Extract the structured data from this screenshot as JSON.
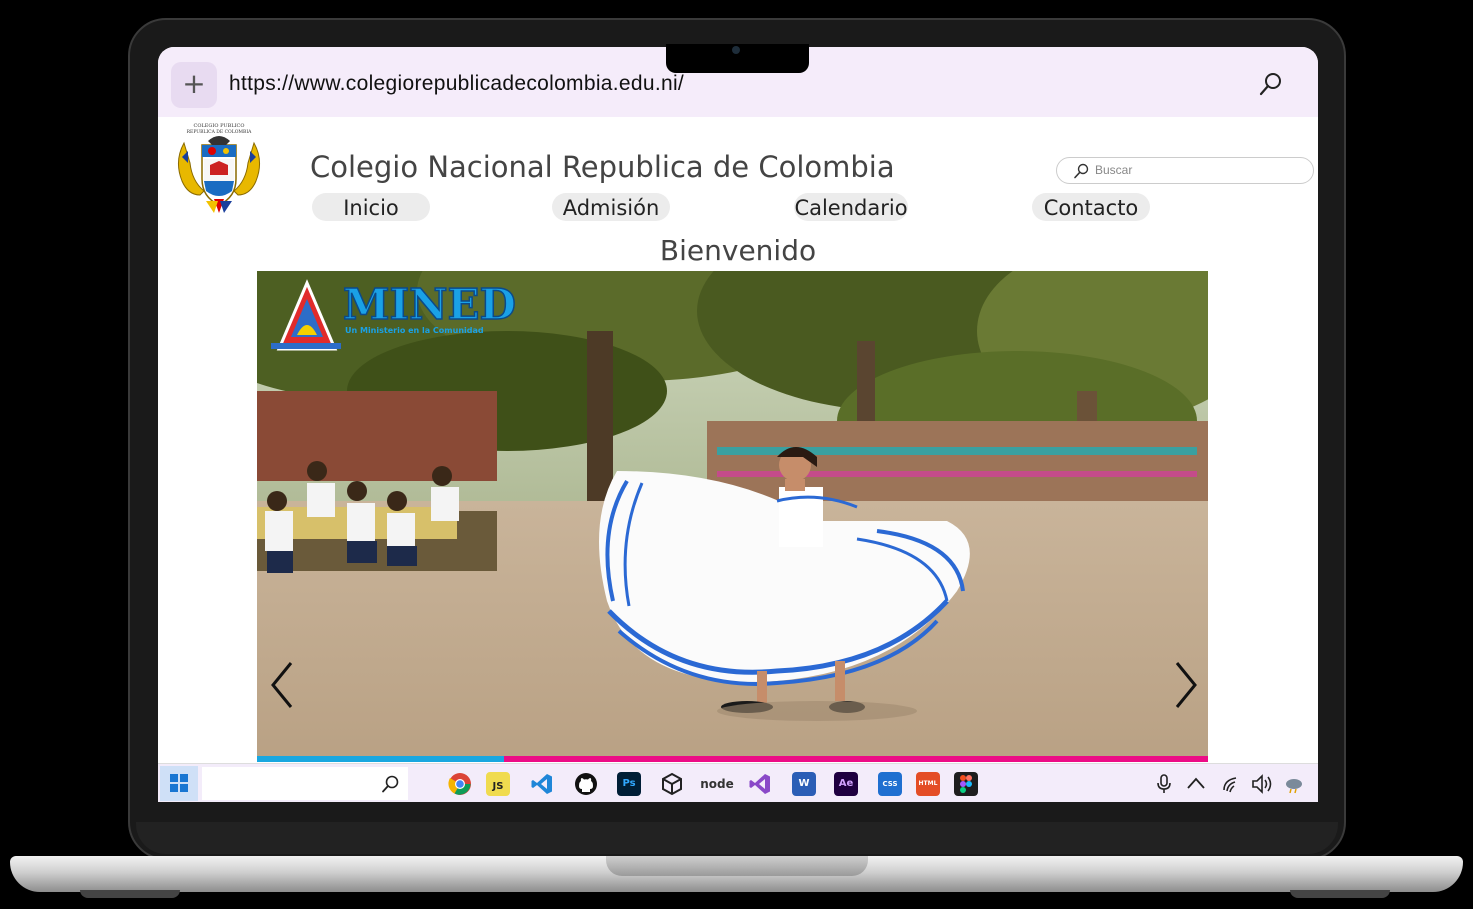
{
  "browser": {
    "url": "https://www.colegiorepublicadecolombia.edu.ni/",
    "new_tab_icon": "+"
  },
  "site": {
    "logo_text_line1": "COLEGIO PUBLICO",
    "logo_text_line2": "REPUBLICA DE COLOMBIA",
    "title": "Colegio Nacional Republica de Colombia",
    "search_placeholder": "Buscar",
    "nav": [
      "Inicio",
      "Admisión",
      "Calendario",
      "Contacto"
    ],
    "welcome": "Bienvenido"
  },
  "carousel": {
    "brand_text": "MINED",
    "brand_subtitle": "Un Ministerio en la Comunidad",
    "progress_fraction": 0.26
  },
  "taskbar": {
    "icons": [
      "windows-start-icon",
      "chrome-icon",
      "javascript-icon",
      "vscode-icon",
      "github-icon",
      "photoshop-icon",
      "unity-icon",
      "nodejs-icon",
      "visual-studio-icon",
      "word-icon",
      "after-effects-icon",
      "css3-icon",
      "html5-icon",
      "figma-icon",
      "microphone-icon",
      "chevron-up-icon",
      "wifi-icon",
      "volume-icon",
      "weather-icon"
    ],
    "labels": {
      "js": "JS",
      "ps": "Ps",
      "node": "node",
      "word": "W",
      "ae": "Ae",
      "css": "CSS",
      "html": "HTML"
    }
  },
  "colors": {
    "browser_bar": "#f5ecfa",
    "progress_active": "#19a7e0",
    "progress_rest": "#ec0c86"
  }
}
